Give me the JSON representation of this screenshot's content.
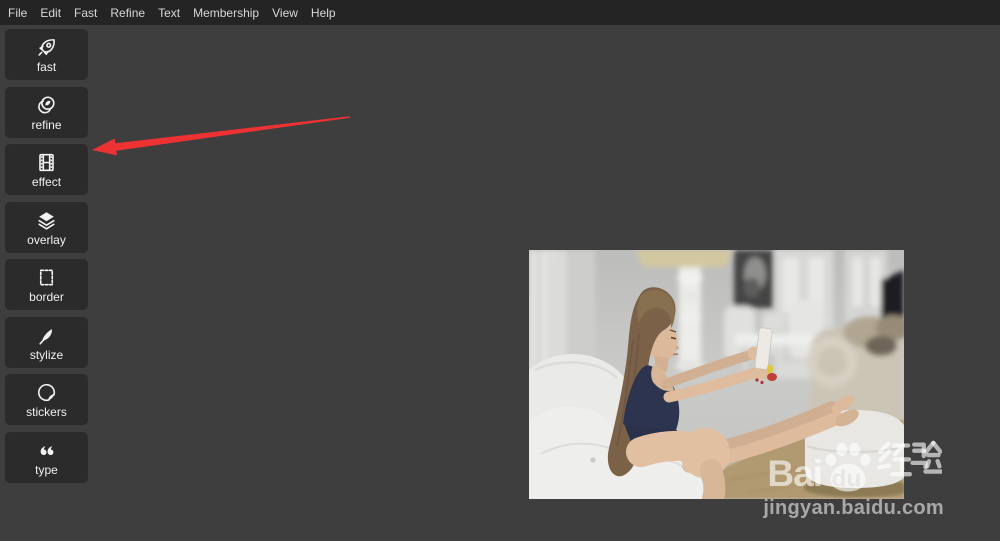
{
  "menu_bar": {
    "items": [
      {
        "label": "File"
      },
      {
        "label": "Edit"
      },
      {
        "label": "Fast"
      },
      {
        "label": "Refine"
      },
      {
        "label": "Text"
      },
      {
        "label": "Membership"
      },
      {
        "label": "View"
      },
      {
        "label": "Help"
      }
    ]
  },
  "sidebar": {
    "tools": [
      {
        "label": "fast",
        "icon": "rocket-icon"
      },
      {
        "label": "refine",
        "icon": "lens-filter-icon"
      },
      {
        "label": "effect",
        "icon": "film-strip-icon"
      },
      {
        "label": "overlay",
        "icon": "layers-icon"
      },
      {
        "label": "border",
        "icon": "stamp-frame-icon"
      },
      {
        "label": "stylize",
        "icon": "feather-icon"
      },
      {
        "label": "stickers",
        "icon": "peeled-sticker-icon"
      },
      {
        "label": "type",
        "icon": "double-quote-icon"
      }
    ]
  },
  "annotation": {
    "arrow_color": "#ec3232",
    "arrow_points_to": "effect tool button"
  },
  "photo": {
    "alt": "Young woman with long brown hair in a dark tank top sitting on a white sofa in a bright living room, photographing her outstretched bare feet with a smartphone"
  },
  "watermark": {
    "brand_prefix": "Bai",
    "brand_paw_text": "du",
    "brand_suffix": "经验",
    "site_url": "jingyan.baidu.com"
  },
  "colors": {
    "menubar_bg": "#242424",
    "canvas_bg": "#3e3e3e",
    "tool_button_bg": "#2b2b2b",
    "accent_red": "#ec3232"
  }
}
